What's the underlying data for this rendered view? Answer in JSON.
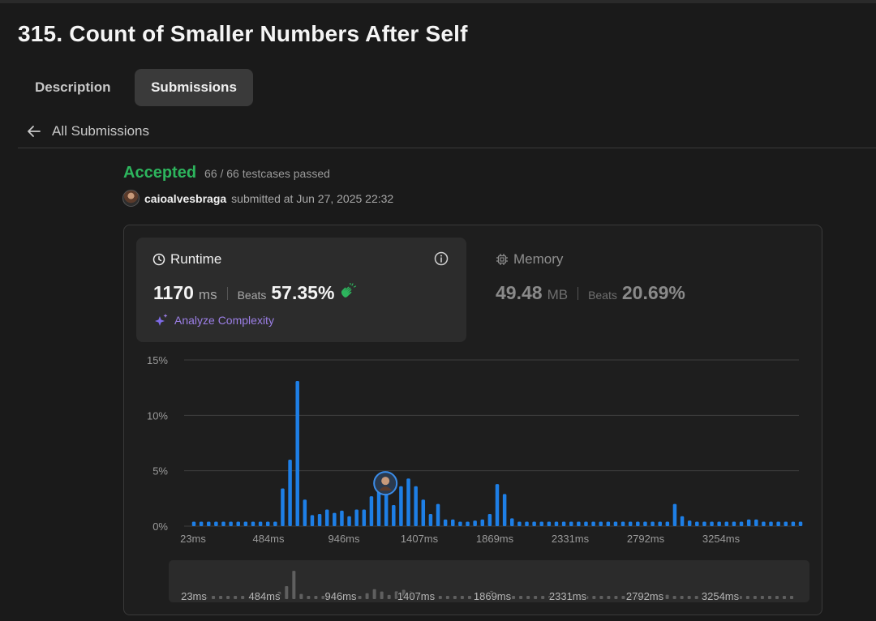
{
  "problem": {
    "title": "315. Count of Smaller Numbers After Self"
  },
  "tabs": [
    {
      "label": "Description"
    },
    {
      "label": "Submissions"
    }
  ],
  "back": {
    "label": "All Submissions"
  },
  "result": {
    "status": "Accepted",
    "testcases": "66 / 66 testcases passed",
    "username": "caioalvesbraga",
    "submitted": "submitted at Jun 27, 2025 22:32"
  },
  "runtime": {
    "label": "Runtime",
    "value": "1170",
    "unit": "ms",
    "beats_label": "Beats",
    "beats": "57.35%",
    "analyze": "Analyze Complexity"
  },
  "memory": {
    "label": "Memory",
    "value": "49.48",
    "unit": "MB",
    "beats_label": "Beats",
    "beats": "20.69%"
  },
  "colors": {
    "accent_green": "#2db55d",
    "bar_blue": "#1e7fe6",
    "analyze_purple": "#9c7fe6"
  },
  "chart_data": {
    "type": "bar",
    "ylabel": "",
    "xlabel": "",
    "yticks": [
      "15%",
      "10%",
      "5%",
      "0%"
    ],
    "ylim": [
      0,
      15
    ],
    "xticks": [
      "23ms",
      "484ms",
      "946ms",
      "1407ms",
      "1869ms",
      "2331ms",
      "2792ms",
      "3254ms"
    ],
    "highlight_index": 26,
    "values": [
      0.4,
      0.4,
      0.4,
      0.4,
      0.4,
      0.4,
      0.4,
      0.4,
      0.4,
      0.4,
      0.4,
      0.4,
      3.4,
      6.0,
      13.1,
      2.4,
      1.0,
      1.1,
      1.5,
      1.2,
      1.4,
      0.9,
      1.5,
      1.5,
      2.7,
      4.6,
      3.5,
      1.9,
      3.6,
      4.3,
      3.6,
      2.4,
      1.1,
      2.0,
      0.6,
      0.6,
      0.4,
      0.4,
      0.5,
      0.6,
      1.1,
      3.8,
      2.9,
      0.7,
      0.4,
      0.4,
      0.4,
      0.4,
      0.4,
      0.4,
      0.4,
      0.4,
      0.4,
      0.4,
      0.4,
      0.4,
      0.4,
      0.4,
      0.4,
      0.4,
      0.4,
      0.4,
      0.4,
      0.4,
      0.4,
      2.0,
      0.9,
      0.5,
      0.4,
      0.4,
      0.4,
      0.4,
      0.4,
      0.4,
      0.4,
      0.6,
      0.6,
      0.4,
      0.4,
      0.4,
      0.4,
      0.4,
      0.4
    ]
  }
}
